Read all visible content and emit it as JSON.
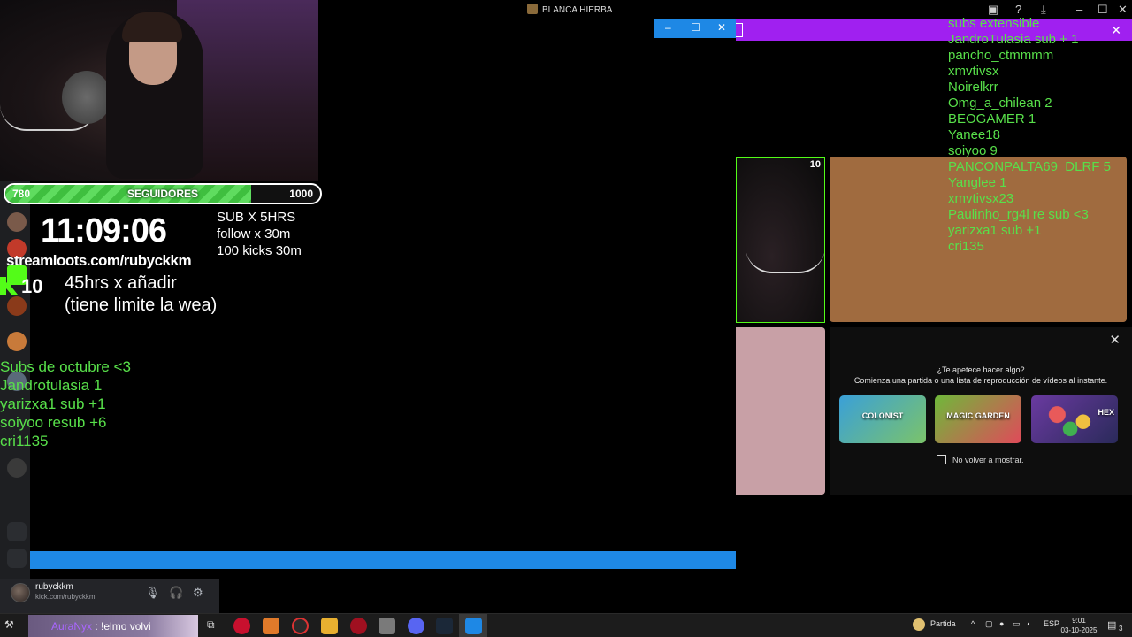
{
  "window": {
    "title": "BLANCA HIERBA"
  },
  "overlay": {
    "follower_goal": {
      "current": "780",
      "label": "SEGUIDORES",
      "target": "1000",
      "progress": 0.78
    },
    "timer": "11:09:06",
    "rules": [
      "SUB X 5HRS",
      "follow x 30m",
      "100 kicks 30m"
    ],
    "streamloots": "streamloots.com/rubyckkm",
    "kick_count": "10",
    "hours_note": [
      "45hrs  x añadir",
      "(tiene limite la wea)"
    ],
    "subs_list": [
      "Subs de octubre <3",
      "Jandrotulasia 1",
      "yarizxa1 sub +1",
      "soiyoo resub +6",
      "cri1135"
    ]
  },
  "right_names": [
    "subs extensible",
    "JandroTulasia sub + 1",
    "pancho_ctmmmm",
    "xmvtivsx",
    "Noirelkrr",
    "Omg_a_chilean 2",
    "BEOGAMER 1",
    "Yanee18",
    "soiyoo 9",
    "PANCONPALTA69_DLRF 5",
    "Yanglee 1",
    "xmvtivsx23",
    "Paulinho_rg4l  re sub <3",
    "yarizxa1 sub +1",
    "cri135"
  ],
  "preview": {
    "tag": "10"
  },
  "promo": {
    "question": "¿Te apetece hacer algo?",
    "subtitle": "Comienza una partida o una lista de reproducción de vídeos al instante.",
    "games": [
      "COLONIST",
      "MAGIC GARDEN",
      "HEX"
    ],
    "checkbox_label": "No volver a mostrar."
  },
  "user_panel": {
    "name": "rubyckkm",
    "subtitle": "kick.com/rubyckkm"
  },
  "taskbar": {
    "chat_user": "AuraNyx",
    "chat_message": " : !elmo volvi",
    "weather": "Partida",
    "lang": "ESP",
    "time": "9:01",
    "date": "03-10-2025",
    "notif_count": "3"
  },
  "colors": {
    "kick_green": "#53fc18",
    "accent_blue": "#1e88e5",
    "purple": "#a020f0",
    "list_green": "#58e04a"
  }
}
